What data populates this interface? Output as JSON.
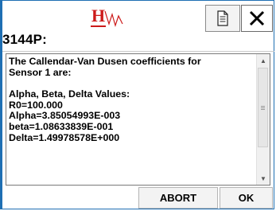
{
  "header": {
    "title": "3144P:",
    "logo_icon": "hart-logo-icon",
    "logo_text": "H",
    "document_icon": "document-icon",
    "close_icon": "close-icon"
  },
  "message": {
    "lines": [
      "The Callendar-Van Dusen coefficients for",
      "Sensor 1 are:",
      "",
      " Alpha, Beta, Delta Values:",
      "R0=100.000",
      "Alpha=3.85054993E-003",
      "beta=1.08633839E-001",
      "Delta=1.49978578E+000"
    ]
  },
  "buttons": {
    "abort_label": "ABORT",
    "ok_label": "OK"
  },
  "colors": {
    "frame": "#1f6fb3",
    "logo_red": "#cc1a1a"
  }
}
